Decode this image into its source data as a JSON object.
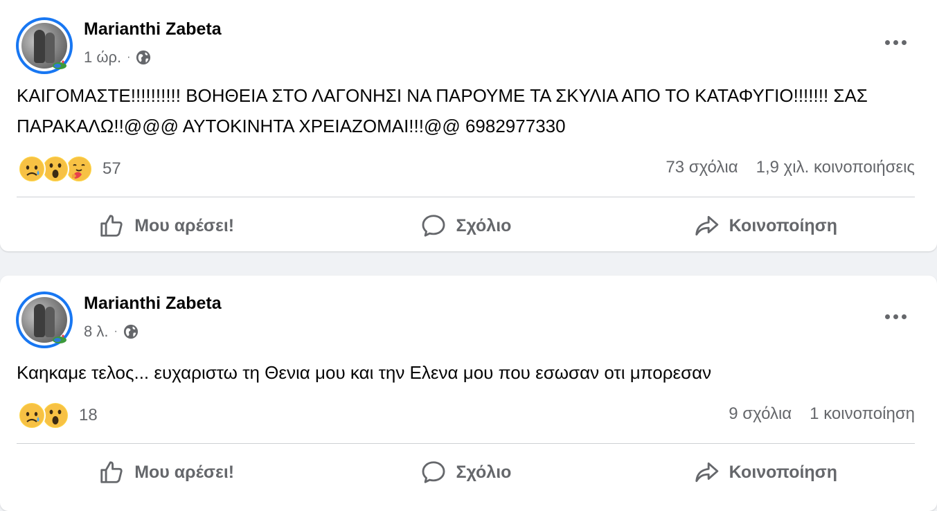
{
  "posts": [
    {
      "author": "Marianthi Zabeta",
      "time": "1 ώρ.",
      "separator": "·",
      "text": "ΚΑΙΓΟΜΑΣΤΕ!!!!!!!!!! ΒΟΗΘΕΙΑ ΣΤΟ ΛΑΓΟΝΗΣΙ ΝΑ ΠΑΡΟΥΜΕ ΤΑ ΣΚΥΛΙΑ ΑΠΟ ΤΟ ΚΑΤΑΦΥΓΙΟ!!!!!!! ΣΑΣ ΠΑΡΑΚΑΛΩ!!@@@ ΑΥΤΟΚΙΝΗΤΑ ΧΡΕΙΑΖΟΜΑΙ!!!@@ 6982977330",
      "reaction_icons": [
        "sad-reaction-icon",
        "wow-reaction-icon",
        "care-reaction-icon"
      ],
      "reaction_count": "57",
      "comments": "73 σχόλια",
      "shares": "1,9 χιλ. κοινοποιήσεις"
    },
    {
      "author": "Marianthi Zabeta",
      "time": "8 λ.",
      "separator": "·",
      "text": "Καηκαμε τελος... ευχαριστω τη Θενια μου και την Ελενα μου που εσωσαν οτι μπορεσαν",
      "reaction_icons": [
        "sad-reaction-icon",
        "wow-reaction-icon"
      ],
      "reaction_count": "18",
      "comments": "9 σχόλια",
      "shares": "1 κοινοποίηση"
    }
  ],
  "actions": {
    "like": "Μου αρέσει!",
    "comment": "Σχόλιο",
    "share": "Κοινοποίηση"
  },
  "colors": {
    "accent": "#1877f2",
    "secondary_text": "#65676b",
    "background": "#f0f2f5"
  }
}
